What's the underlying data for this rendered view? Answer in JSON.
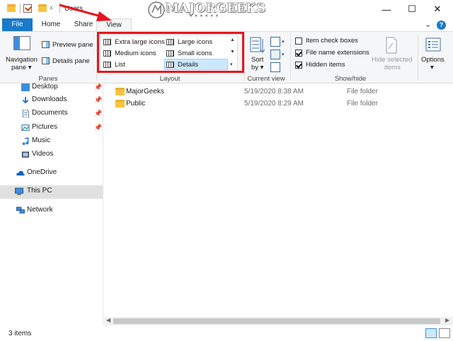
{
  "window": {
    "title": "Users",
    "minimize_glyph": "—",
    "maximize_glyph": "☐",
    "close_glyph": "✕"
  },
  "watermark": {
    "text": "MAJORGEEKS",
    "stars": "★★★★★★"
  },
  "ribbon": {
    "tabs": [
      {
        "label": "File",
        "active": false
      },
      {
        "label": "Home",
        "active": false
      },
      {
        "label": "Share",
        "active": false
      },
      {
        "label": "View",
        "active": true
      }
    ],
    "expand_glyph": "⌄",
    "help_glyph": "?",
    "panes_group": {
      "label": "Panes",
      "navigation_pane_line1": "Navigation",
      "navigation_pane_line2": "pane ▾",
      "preview_pane": "Preview pane",
      "details_pane": "Details pane"
    },
    "layout_group": {
      "label": "Layout",
      "items": [
        "Extra large icons",
        "Large icons",
        "Medium icons",
        "Small icons",
        "List",
        "Details"
      ],
      "selected": "Details"
    },
    "current_view_group": {
      "label": "Current view",
      "sort_line1": "Sort",
      "sort_line2": "by ▾"
    },
    "show_hide_group": {
      "label": "Show/hide",
      "checkboxes": [
        {
          "label": "Item check boxes",
          "checked": false
        },
        {
          "label": "File name extensions",
          "checked": true
        },
        {
          "label": "Hidden items",
          "checked": true
        }
      ],
      "hide_selected_line1": "Hide selected",
      "hide_selected_line2": "items",
      "options_label": "Options",
      "options_arrow": "▾"
    }
  },
  "nav": {
    "items": [
      {
        "label": "Desktop",
        "icon": "desktop-icon",
        "pinned": true
      },
      {
        "label": "Downloads",
        "icon": "download-icon",
        "pinned": true
      },
      {
        "label": "Documents",
        "icon": "documents-icon",
        "pinned": true
      },
      {
        "label": "Pictures",
        "icon": "pictures-icon",
        "pinned": true
      },
      {
        "label": "Music",
        "icon": "music-icon",
        "pinned": false
      },
      {
        "label": "Videos",
        "icon": "videos-icon",
        "pinned": false
      },
      {
        "label": "OneDrive",
        "icon": "onedrive-icon",
        "pinned": false
      },
      {
        "label": "This PC",
        "icon": "pc-icon",
        "pinned": false,
        "selected": true
      },
      {
        "label": "Network",
        "icon": "network-icon",
        "pinned": false
      }
    ]
  },
  "files": [
    {
      "name": "MajorGeeks",
      "date": "5/19/2020 8:38 AM",
      "type": "File folder"
    },
    {
      "name": "Public",
      "date": "5/19/2020 8:29 AM",
      "type": "File folder"
    }
  ],
  "status": {
    "item_count": "3 items"
  },
  "colors": {
    "accent": "#1979ca",
    "highlight_box": "#e8141b",
    "selection": "#cce8ff"
  }
}
